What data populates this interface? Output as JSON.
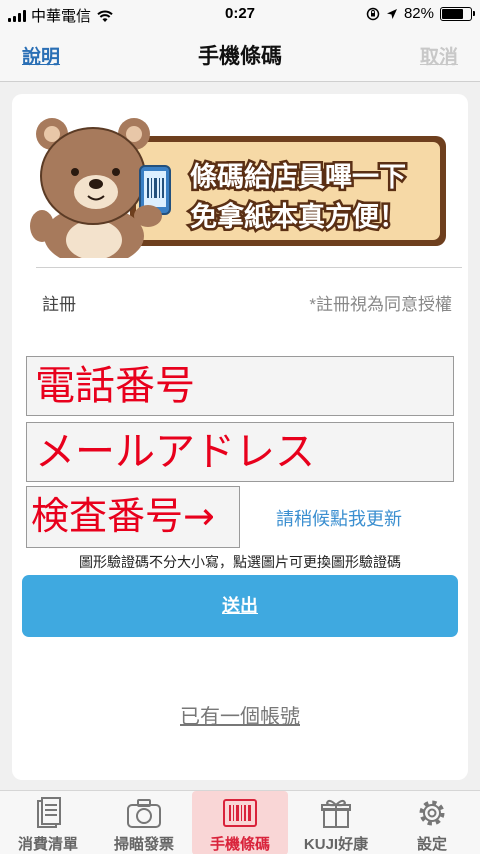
{
  "status_bar": {
    "carrier": "中華電信",
    "time": "0:27",
    "battery": "82%",
    "battery_level": 0.82
  },
  "nav": {
    "left_label": "說明",
    "title": "手機條碼",
    "right_label": "取消"
  },
  "banner": {
    "line1": "條碼給店員嗶一下",
    "line2": "免拿紙本真方便！"
  },
  "registration": {
    "label": "註冊",
    "note": "*註冊視為同意授權"
  },
  "form": {
    "phone_value": "電話番号",
    "email_value": "メールアドレス",
    "captcha_value": "検査番号→",
    "captcha_refresh": "請稍候點我更新",
    "captcha_hint": "圖形驗證碼不分大小寫，點選圖片可更換圖形驗證碼",
    "submit_label": "送出",
    "have_account": "已有一個帳號"
  },
  "tabs": [
    {
      "label": "消費清單",
      "icon": "receipt-list-icon"
    },
    {
      "label": "掃瞄發票",
      "icon": "camera-icon"
    },
    {
      "label": "手機條碼",
      "icon": "barcode-icon",
      "active": true
    },
    {
      "label": "KUJI好康",
      "icon": "gift-icon"
    },
    {
      "label": "設定",
      "icon": "gear-icon"
    }
  ],
  "colors": {
    "accent_blue": "#3fa9e0",
    "link_blue": "#2a6fb5",
    "active_tab": "#d9233b",
    "input_text_red": "#e8001c"
  }
}
